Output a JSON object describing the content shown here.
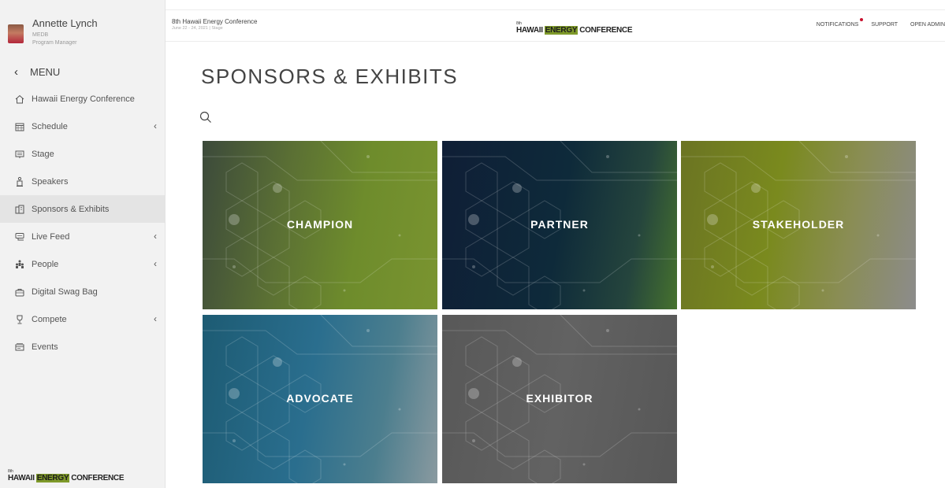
{
  "user": {
    "name": "Annette Lynch",
    "org": "MEDB",
    "role": "Program Manager"
  },
  "menu": {
    "label": "MENU"
  },
  "nav": [
    {
      "label": "Hawaii Energy Conference",
      "icon": "home-icon",
      "caret": false,
      "active": false
    },
    {
      "label": "Schedule",
      "icon": "calendar-icon",
      "caret": true,
      "active": false
    },
    {
      "label": "Stage",
      "icon": "stage-icon",
      "caret": false,
      "active": false
    },
    {
      "label": "Speakers",
      "icon": "podium-icon",
      "caret": false,
      "active": false
    },
    {
      "label": "Sponsors & Exhibits",
      "icon": "building-icon",
      "caret": false,
      "active": true
    },
    {
      "label": "Live Feed",
      "icon": "feed-icon",
      "caret": true,
      "active": false
    },
    {
      "label": "People",
      "icon": "people-icon",
      "caret": true,
      "active": false
    },
    {
      "label": "Digital Swag Bag",
      "icon": "bag-icon",
      "caret": false,
      "active": false
    },
    {
      "label": "Compete",
      "icon": "trophy-icon",
      "caret": true,
      "active": false
    },
    {
      "label": "Events",
      "icon": "ticket-icon",
      "caret": false,
      "active": false
    }
  ],
  "logo": {
    "super": "8th",
    "part1": "HAWAII",
    "part2": "ENERGY",
    "part3": "CONFERENCE"
  },
  "topbar": {
    "title": "8th Hawaii Energy Conference",
    "dates": "June 22 - 24, 2021  |  Stage",
    "notifications": "NOTIFICATIONS",
    "support": "SUPPORT",
    "open_admin": "OPEN ADMIN"
  },
  "page": {
    "title": "SPONSORS & EXHIBITS"
  },
  "tiles": [
    "CHAMPION",
    "PARTNER",
    "STAKEHOLDER",
    "ADVOCATE",
    "EXHIBITOR"
  ],
  "colors": {
    "accent": "#7f9a2a",
    "notification_dot": "#c8102e",
    "active_nav": "#e4e4e4"
  }
}
